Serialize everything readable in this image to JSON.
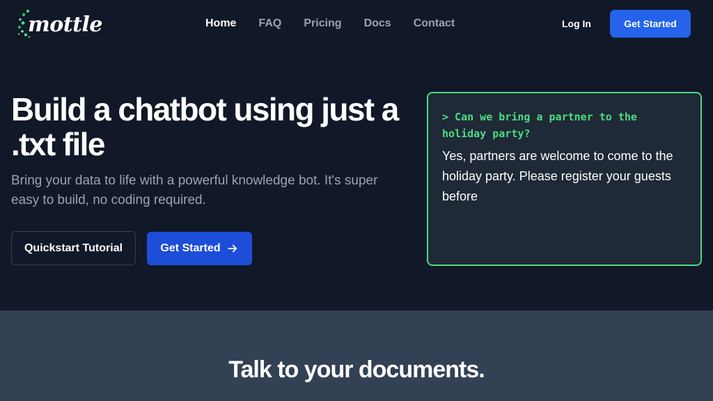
{
  "brand": {
    "name": "mottle"
  },
  "nav": {
    "links": [
      {
        "label": "Home"
      },
      {
        "label": "FAQ"
      },
      {
        "label": "Pricing"
      },
      {
        "label": "Docs"
      },
      {
        "label": "Contact"
      }
    ],
    "login_label": "Log In",
    "cta_label": "Get Started"
  },
  "hero": {
    "title": "Build a chatbot using just a .txt file",
    "subtitle": "Bring your data to life with a powerful knowledge bot. It's super easy to build, no coding required.",
    "secondary_button": "Quickstart Tutorial",
    "primary_button": "Get Started"
  },
  "terminal": {
    "question": "> Can we bring a partner to the holiday party?",
    "answer": "Yes, partners are welcome to come to the holiday party. Please register your guests before"
  },
  "section2": {
    "title": "Talk to your documents."
  },
  "colors": {
    "background": "#111827",
    "accent_blue": "#2563eb",
    "accent_green": "#4ade80",
    "section_bg": "#334155"
  },
  "icons": {
    "logo": "dotted-logo-icon",
    "arrow": "arrow-right-icon"
  }
}
